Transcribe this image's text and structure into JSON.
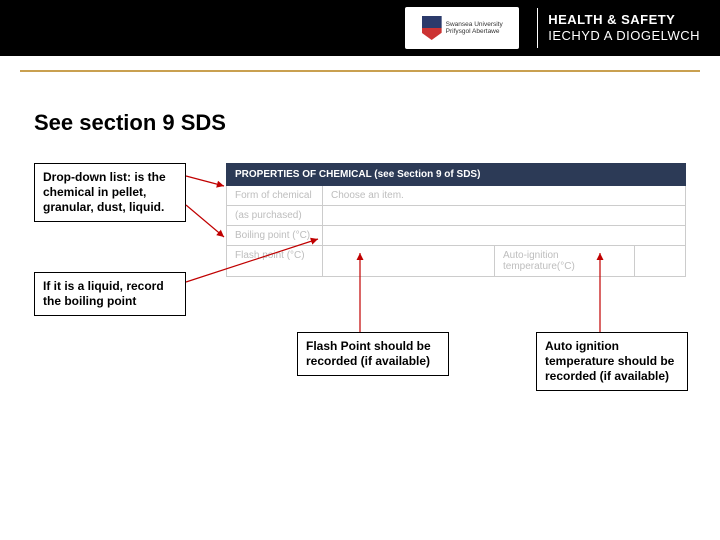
{
  "header": {
    "university_line1": "Swansea University",
    "university_line2": "Prifysgol Abertawe",
    "brand_line1": "HEALTH & SAFETY",
    "brand_line2": "IECHYD A DIOGELWCH"
  },
  "heading": "See section 9 SDS",
  "callouts": {
    "dropdown": "Drop-down list: is the chemical in pellet, granular, dust, liquid.",
    "liquid": "If it is a liquid, record the boiling point",
    "flash": "Flash Point should be recorded  (if available)",
    "auto": "Auto ignition temperature should be recorded (if available)"
  },
  "form": {
    "section_title": "PROPERTIES OF CHEMICAL (see Section 9 of SDS)",
    "rows": {
      "form_of_chemical_label": "Form of chemical",
      "form_of_chemical_value": "Choose an item.",
      "as_purchased_label": "(as purchased)",
      "boiling_label": "Boiling point (°C)",
      "flash_label": "Flash point (°C)",
      "auto_label": "Auto-ignition temperature(°C)"
    }
  },
  "colors": {
    "gold_rule": "#c9a050",
    "panel_header": "#2c3a56",
    "arrow": "#c00000"
  }
}
